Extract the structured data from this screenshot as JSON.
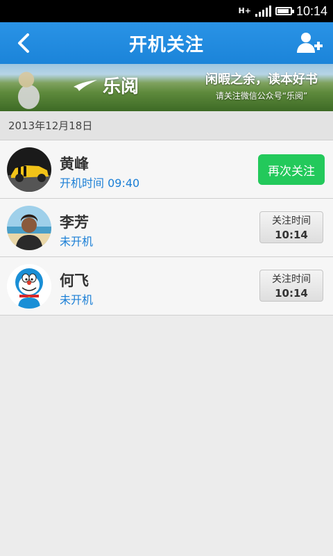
{
  "status_bar": {
    "network": "H+",
    "time": "10:14"
  },
  "header": {
    "title": "开机关注"
  },
  "banner": {
    "logo_text": "乐阅",
    "line1": "闲暇之余，读本好书",
    "line2": "请关注微信公众号“乐阅”"
  },
  "date_label": "2013年12月18日",
  "contacts": [
    {
      "name": "黄峰",
      "status": "开机时间 09:40",
      "action": "再次关注"
    },
    {
      "name": "李芳",
      "status": "未开机",
      "action_label": "关注时间",
      "action_time": "10:14"
    },
    {
      "name": "何飞",
      "status": "未开机",
      "action_label": "关注时间",
      "action_time": "10:14"
    }
  ],
  "colors": {
    "header": "#1b84d9",
    "accent_green": "#23c95b",
    "status_blue": "#1b7fd6"
  }
}
